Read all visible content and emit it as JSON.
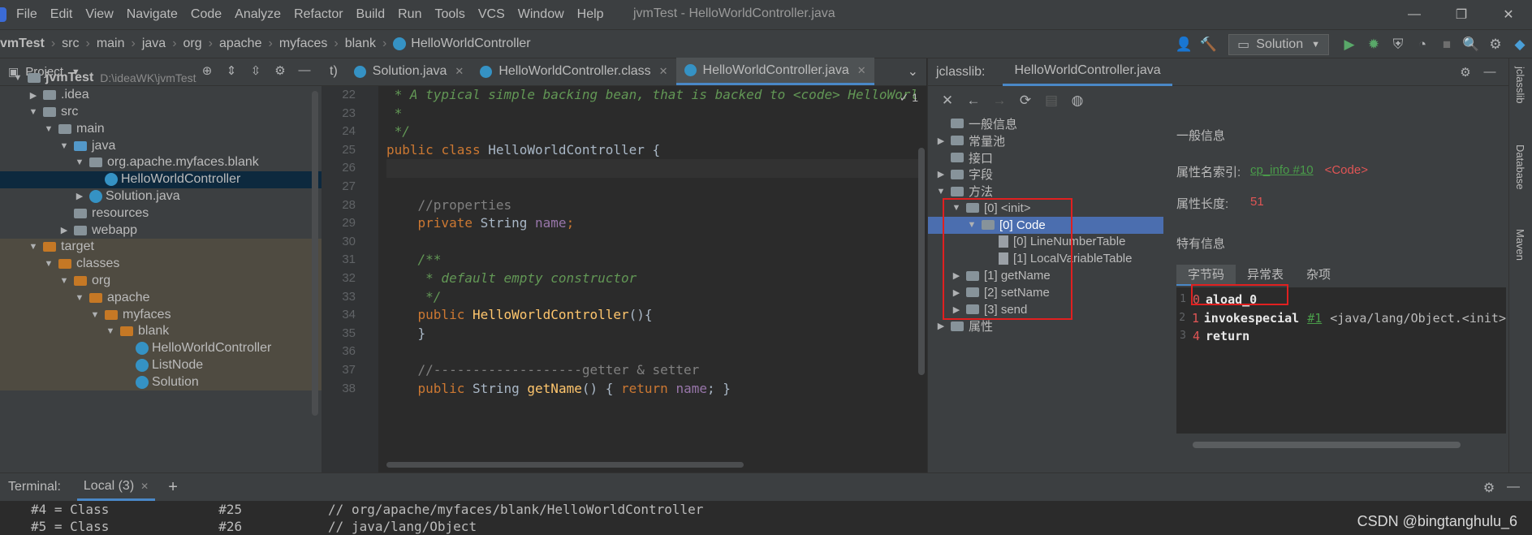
{
  "menubar": {
    "items": [
      "File",
      "Edit",
      "View",
      "Navigate",
      "Code",
      "Analyze",
      "Refactor",
      "Build",
      "Run",
      "Tools",
      "VCS",
      "Window",
      "Help"
    ],
    "window_title": "jvmTest - HelloWorldController.java"
  },
  "navbar": {
    "crumbs": [
      "vmTest",
      "src",
      "main",
      "java",
      "org",
      "apache",
      "myfaces",
      "blank",
      "HelloWorldController"
    ],
    "run_config": "Solution"
  },
  "project": {
    "title": "Project",
    "tree": [
      {
        "label": "jvmTest",
        "path": "D:\\ideaWK\\jvmTest",
        "indent": 0,
        "arrow": "down",
        "type": "folder"
      },
      {
        "label": ".idea",
        "indent": 1,
        "arrow": "right",
        "type": "folder"
      },
      {
        "label": "src",
        "indent": 1,
        "arrow": "down",
        "type": "folder"
      },
      {
        "label": "main",
        "indent": 2,
        "arrow": "down",
        "type": "folder"
      },
      {
        "label": "java",
        "indent": 3,
        "arrow": "down",
        "type": "folder-blue"
      },
      {
        "label": "org.apache.myfaces.blank",
        "indent": 4,
        "arrow": "down",
        "type": "folder"
      },
      {
        "label": "HelloWorldController",
        "indent": 5,
        "arrow": "",
        "type": "class",
        "selected": true
      },
      {
        "label": "Solution.java",
        "indent": 4,
        "arrow": "right",
        "type": "class"
      },
      {
        "label": "resources",
        "indent": 3,
        "arrow": "",
        "type": "folder"
      },
      {
        "label": "webapp",
        "indent": 3,
        "arrow": "right",
        "type": "folder"
      },
      {
        "label": "target",
        "indent": 1,
        "arrow": "down",
        "type": "folder-orange",
        "excluded": true
      },
      {
        "label": "classes",
        "indent": 2,
        "arrow": "down",
        "type": "folder-orange",
        "excluded": true
      },
      {
        "label": "org",
        "indent": 3,
        "arrow": "down",
        "type": "folder-orange",
        "excluded": true
      },
      {
        "label": "apache",
        "indent": 4,
        "arrow": "down",
        "type": "folder-orange",
        "excluded": true
      },
      {
        "label": "myfaces",
        "indent": 5,
        "arrow": "down",
        "type": "folder-orange",
        "excluded": true
      },
      {
        "label": "blank",
        "indent": 6,
        "arrow": "down",
        "type": "folder-orange",
        "excluded": true
      },
      {
        "label": "HelloWorldController",
        "indent": 7,
        "arrow": "",
        "type": "class",
        "excluded": true
      },
      {
        "label": "ListNode",
        "indent": 7,
        "arrow": "",
        "type": "class",
        "excluded": true
      },
      {
        "label": "Solution",
        "indent": 7,
        "arrow": "",
        "type": "class",
        "excluded": true
      }
    ]
  },
  "editor": {
    "tabs": [
      {
        "label": "t)",
        "active": false,
        "closable": false
      },
      {
        "label": "Solution.java",
        "active": false,
        "closable": true
      },
      {
        "label": "HelloWorldController.class",
        "active": false,
        "closable": true
      },
      {
        "label": "HelloWorldController.java",
        "active": true,
        "closable": true
      }
    ],
    "inspection_count": "✓ 1",
    "line_numbers": [
      "22",
      "23",
      "24",
      "25",
      "26",
      "27",
      "28",
      "29",
      "30",
      "31",
      "32",
      "33",
      "34",
      "35",
      "36",
      "37",
      "38"
    ],
    "lines": [
      [
        {
          "t": " * A typical simple backing bean, that is backed to <code> HelloWorl",
          "c": "doc"
        }
      ],
      [
        {
          "t": " *",
          "c": "doc"
        }
      ],
      [
        {
          "t": " */",
          "c": "doc"
        }
      ],
      [
        {
          "t": "public ",
          "c": "k"
        },
        {
          "t": "class ",
          "c": "k"
        },
        {
          "t": "HelloWorldController {",
          "c": ""
        }
      ],
      [
        {
          "t": "",
          "c": ""
        }
      ],
      [
        {
          "t": "",
          "c": ""
        }
      ],
      [
        {
          "t": "    //properties",
          "c": "cm"
        }
      ],
      [
        {
          "t": "    private ",
          "c": "k"
        },
        {
          "t": "String ",
          "c": ""
        },
        {
          "t": "name",
          "c": "fld"
        },
        {
          "t": ";",
          "c": "k"
        }
      ],
      [
        {
          "t": "",
          "c": ""
        }
      ],
      [
        {
          "t": "    /**",
          "c": "doc"
        }
      ],
      [
        {
          "t": "     * default empty constructor",
          "c": "doc"
        }
      ],
      [
        {
          "t": "     */",
          "c": "doc"
        }
      ],
      [
        {
          "t": "    public ",
          "c": "k"
        },
        {
          "t": "HelloWorldController",
          "c": "fn"
        },
        {
          "t": "(){",
          "c": ""
        }
      ],
      [
        {
          "t": "    }",
          "c": ""
        }
      ],
      [
        {
          "t": "",
          "c": ""
        }
      ],
      [
        {
          "t": "    //-------------------getter & setter",
          "c": "cm"
        }
      ],
      [
        {
          "t": "    public ",
          "c": "k"
        },
        {
          "t": "String ",
          "c": ""
        },
        {
          "t": "getName",
          "c": "fn"
        },
        {
          "t": "() { ",
          "c": ""
        },
        {
          "t": "return ",
          "c": "k"
        },
        {
          "t": "name",
          "c": "fld"
        },
        {
          "t": "; }",
          "c": ""
        }
      ]
    ],
    "current_line": 4
  },
  "jclasslib": {
    "label": "jclasslib:",
    "tab": "HelloWorldController.java",
    "tree": [
      {
        "label": "一般信息",
        "indent": 0,
        "arrow": "",
        "type": "folder"
      },
      {
        "label": "常量池",
        "indent": 0,
        "arrow": "right",
        "type": "folder"
      },
      {
        "label": "接口",
        "indent": 0,
        "arrow": "",
        "type": "folder"
      },
      {
        "label": "字段",
        "indent": 0,
        "arrow": "right",
        "type": "folder"
      },
      {
        "label": "方法",
        "indent": 0,
        "arrow": "down",
        "type": "folder"
      },
      {
        "label": "[0] <init>",
        "indent": 1,
        "arrow": "down",
        "type": "folder"
      },
      {
        "label": "[0] Code",
        "indent": 2,
        "arrow": "down",
        "type": "folder",
        "selected": true
      },
      {
        "label": "[0] LineNumberTable",
        "indent": 3,
        "arrow": "",
        "type": "file"
      },
      {
        "label": "[1] LocalVariableTable",
        "indent": 3,
        "arrow": "",
        "type": "file"
      },
      {
        "label": "[1] getName",
        "indent": 1,
        "arrow": "right",
        "type": "folder"
      },
      {
        "label": "[2] setName",
        "indent": 1,
        "arrow": "right",
        "type": "folder"
      },
      {
        "label": "[3] send",
        "indent": 1,
        "arrow": "right",
        "type": "folder"
      },
      {
        "label": "属性",
        "indent": 0,
        "arrow": "right",
        "type": "folder"
      }
    ],
    "info": {
      "general_title": "一般信息",
      "attr_name_index_label": "属性名索引:",
      "attr_name_index_link": "cp_info #10",
      "attr_name_index_value": "<Code>",
      "attr_length_label": "属性长度:",
      "attr_length_value": "51",
      "specific_title": "特有信息",
      "subtabs": [
        "字节码",
        "异常表",
        "杂项"
      ]
    },
    "bytecode": [
      {
        "n": "1",
        "off": "0",
        "op": "aload_0",
        "arg": "",
        "cmt": ""
      },
      {
        "n": "2",
        "off": "1",
        "op": "invokespecial",
        "arg": "#1",
        "cmt": "<java/lang/Object.<init>"
      },
      {
        "n": "3",
        "off": "4",
        "op": "return",
        "arg": "",
        "cmt": ""
      }
    ]
  },
  "right_strip": [
    "jclasslib",
    "Database",
    "Maven"
  ],
  "terminal": {
    "label": "Terminal:",
    "tab": "Local (3)",
    "lines": [
      "#4 = Class              #25           // org/apache/myfaces/blank/HelloWorldController",
      "#5 = Class              #26           // java/lang/Object"
    ]
  },
  "watermark": "CSDN @bingtanghulu_6"
}
